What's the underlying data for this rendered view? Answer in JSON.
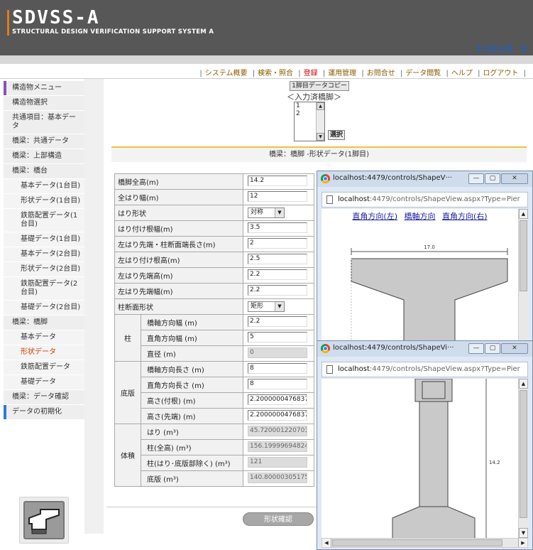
{
  "header": {
    "logo": "SDVSS-A",
    "subtitle": "STRUCTURAL DESIGN VERIFICATION SUPPORT SYSTEM A",
    "brand": "FORUM 8"
  },
  "topnav": [
    "システム概要",
    "検索・照合",
    "登録",
    "運用管理",
    "お問合せ",
    "データ閲覧",
    "ヘルプ",
    "ログアウト"
  ],
  "sidebar": [
    {
      "label": "構造物メニュー",
      "marker": "#8a4fc6",
      "sub": false
    },
    {
      "label": "構造物選択",
      "marker": "",
      "sub": false
    },
    {
      "label": "共通項目：基本データ",
      "marker": "",
      "sub": false
    },
    {
      "label": "橋梁：共通データ",
      "marker": "",
      "sub": false
    },
    {
      "label": "橋梁：上部構造",
      "marker": "",
      "sub": false
    },
    {
      "label": "橋梁：橋台",
      "marker": "",
      "sub": false
    },
    {
      "label": "基本データ(1台目)",
      "marker": "",
      "sub": true
    },
    {
      "label": "形状データ(1台目)",
      "marker": "",
      "sub": true
    },
    {
      "label": "鉄筋配置データ(1台目)",
      "marker": "",
      "sub": true
    },
    {
      "label": "基礎データ(1台目)",
      "marker": "",
      "sub": true
    },
    {
      "label": "基本データ(2台目)",
      "marker": "",
      "sub": true
    },
    {
      "label": "形状データ(2台目)",
      "marker": "",
      "sub": true
    },
    {
      "label": "鉄筋配置データ(2台目)",
      "marker": "",
      "sub": true
    },
    {
      "label": "基礎データ(2台目)",
      "marker": "",
      "sub": true
    },
    {
      "label": "橋梁：橋脚",
      "marker": "",
      "sub": false
    },
    {
      "label": "基本データ",
      "marker": "",
      "sub": true
    },
    {
      "label": "形状データ",
      "marker": "",
      "sub": true,
      "active": true
    },
    {
      "label": "鉄筋配置データ",
      "marker": "",
      "sub": true
    },
    {
      "label": "基礎データ",
      "marker": "",
      "sub": true
    },
    {
      "label": "橋梁：データ確認",
      "marker": "",
      "sub": false
    },
    {
      "label": "データの初期化",
      "marker": "#2d7bd6",
      "sub": false
    }
  ],
  "main": {
    "copy_button": "1脚目データコピー",
    "input_label": "＜入力済橋脚＞",
    "list_items": [
      "1",
      "2"
    ],
    "select_button": "選択",
    "section_title": "橋梁：橋脚 -形状データ(1脚目)",
    "shape_button": "形状確認"
  },
  "form": {
    "r1": {
      "label": "橋脚全高(m)",
      "value": "14.2"
    },
    "r2": {
      "label": "全はり幅(m)",
      "value": "12"
    },
    "r3": {
      "label": "はり形状",
      "value": "対称"
    },
    "r4": {
      "label": "はり付け根幅(m)",
      "value": "3.5"
    },
    "r5": {
      "label": "左はり先端・柱断面端長さ(m)",
      "value": "2"
    },
    "r6": {
      "label": "左はり付け根高(m)",
      "value": "2.5"
    },
    "r7": {
      "label": "左はり先端高(m)",
      "value": "2.2"
    },
    "r8": {
      "label": "左はり先端幅(m)",
      "value": "2.2"
    },
    "r9": {
      "label": "柱断面形状",
      "value": "矩形"
    },
    "col_group": "柱",
    "c1": {
      "label": "橋軸方向幅 (m)",
      "value": "2.2"
    },
    "c2": {
      "label": "直角方向幅 (m)",
      "value": "5"
    },
    "c3": {
      "label": "直径 (m)",
      "value": "0"
    },
    "base_group": "底版",
    "b1": {
      "label": "橋軸方向長さ (m)",
      "value": "8"
    },
    "b2": {
      "label": "直角方向長さ (m)",
      "value": "8"
    },
    "b3": {
      "label": "高さ(付根) (m)",
      "value": "2.2000000476837"
    },
    "b4": {
      "label": "高さ(先端) (m)",
      "value": "2.2000000476837"
    },
    "vol_group": "体積",
    "v1": {
      "label": "はり (m³)",
      "value": "45.720001220703"
    },
    "v2": {
      "label": "柱(全高) (m³)",
      "value": "156.19999694824"
    },
    "v3": {
      "label": "柱(はり･底版部除く) (m³)",
      "value": "121"
    },
    "v4": {
      "label": "底版 (m³)",
      "value": "140.80000305175"
    }
  },
  "popup1": {
    "title": "localhost:4479/controls/ShapeV···",
    "url_host": "localhost",
    "url_path": ":4479/controls/ShapeView.aspx?Type=Pier",
    "links": [
      "直角方向(左)",
      "橋軸方向",
      "直角方向(右)"
    ],
    "dimension": "17.0"
  },
  "popup2": {
    "title": "localhost:4479/controls/ShapeVi···",
    "url_host": "localhost",
    "url_path": ":4479/controls/ShapeView.aspx?Type=Pier",
    "dimension": "14.2"
  }
}
